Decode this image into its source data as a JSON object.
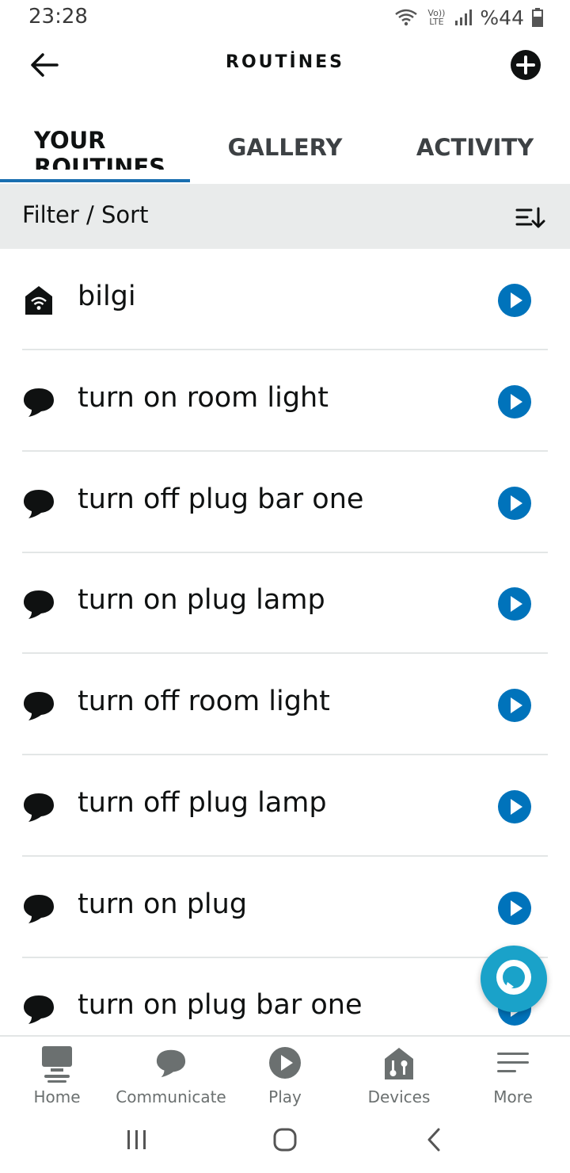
{
  "status_bar": {
    "time": "23:28",
    "network_label": "Vo)) LTE",
    "battery_text": "%44"
  },
  "header": {
    "title": "ROUTİNES",
    "back_icon": "arrow-left-icon",
    "add_icon": "plus-circle-icon"
  },
  "tabs": [
    {
      "label": "YOUR ROUTINES",
      "selected": true
    },
    {
      "label": "GALLERY",
      "selected": false
    },
    {
      "label": "ACTIVITY",
      "selected": false
    }
  ],
  "filter_bar": {
    "label": "Filter / Sort",
    "icon": "sort-icon"
  },
  "routines": [
    {
      "name": "bilgi",
      "icon": "smart-home-icon"
    },
    {
      "name": "turn on room light",
      "icon": "speech-bubble-icon"
    },
    {
      "name": "turn off plug bar one",
      "icon": "speech-bubble-icon"
    },
    {
      "name": "turn on plug lamp",
      "icon": "speech-bubble-icon"
    },
    {
      "name": "turn off room light",
      "icon": "speech-bubble-icon"
    },
    {
      "name": "turn off plug lamp",
      "icon": "speech-bubble-icon"
    },
    {
      "name": "turn on plug",
      "icon": "speech-bubble-icon"
    },
    {
      "name": "turn on plug bar one",
      "icon": "speech-bubble-icon"
    }
  ],
  "bottom_nav": [
    {
      "label": "Home",
      "icon": "home-icon"
    },
    {
      "label": "Communicate",
      "icon": "communicate-icon"
    },
    {
      "label": "Play",
      "icon": "play-icon"
    },
    {
      "label": "Devices",
      "icon": "devices-icon"
    },
    {
      "label": "More",
      "icon": "menu-icon"
    }
  ],
  "colors": {
    "accent_blue": "#1a6fb0",
    "play_blue": "#0073bb",
    "alexa_cyan": "#1aa2c9",
    "filter_bg": "#e9ebeb"
  }
}
